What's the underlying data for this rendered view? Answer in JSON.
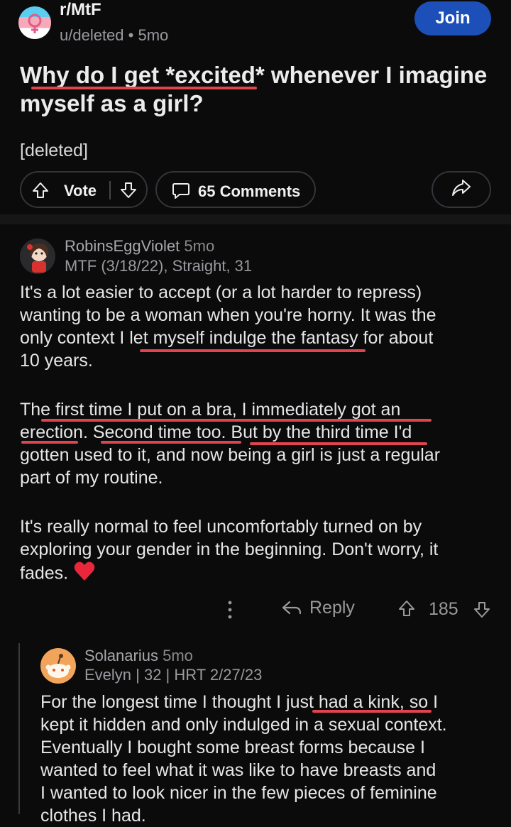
{
  "post": {
    "subreddit": "r/MtF",
    "author": "u/deleted",
    "age": "5mo",
    "meta_sep": "•",
    "join_label": "Join",
    "title_line1": "Why do I get *excited* whenever I imagine",
    "title_line2": "myself as a girl?",
    "body": "[deleted]",
    "vote_label": "Vote",
    "comments_label": "65 Comments"
  },
  "comments": [
    {
      "username": "RobinsEggViolet",
      "age": "5mo",
      "flair": "MTF (3/18/22), Straight, 31",
      "paragraphs": [
        [
          "It's a lot easier to accept (or a lot harder to repress)",
          "wanting to be a woman when you're horny. It was the",
          "only context I let myself indulge the fantasy for about",
          "10 years."
        ],
        [
          "The first time I put on a bra, I immediately got an",
          "erection. Second time too. But by the third time I'd",
          "gotten used to it, and now being a girl is just a regular",
          "part of my routine."
        ],
        [
          "It's really normal to feel uncomfortably turned on by",
          "exploring your gender in the beginning. Don't worry, it",
          "fades."
        ]
      ],
      "reply_label": "Reply",
      "score": "185"
    },
    {
      "username": "Solanarius",
      "age": "5mo",
      "flair": "Evelyn | 32 | HRT 2/27/23",
      "lines": [
        "For the longest time I thought I just had a kink, so I",
        "kept it hidden and only indulged in a sexual context.",
        "Eventually I bought some breast forms because I",
        "wanted to feel what it was like to have breasts and",
        "I wanted to look nicer in the few pieces of feminine",
        "clothes I had."
      ]
    }
  ],
  "colors": {
    "join": "#1c4fb8",
    "underline": "#e0454f",
    "background": "#0b0b0c"
  }
}
